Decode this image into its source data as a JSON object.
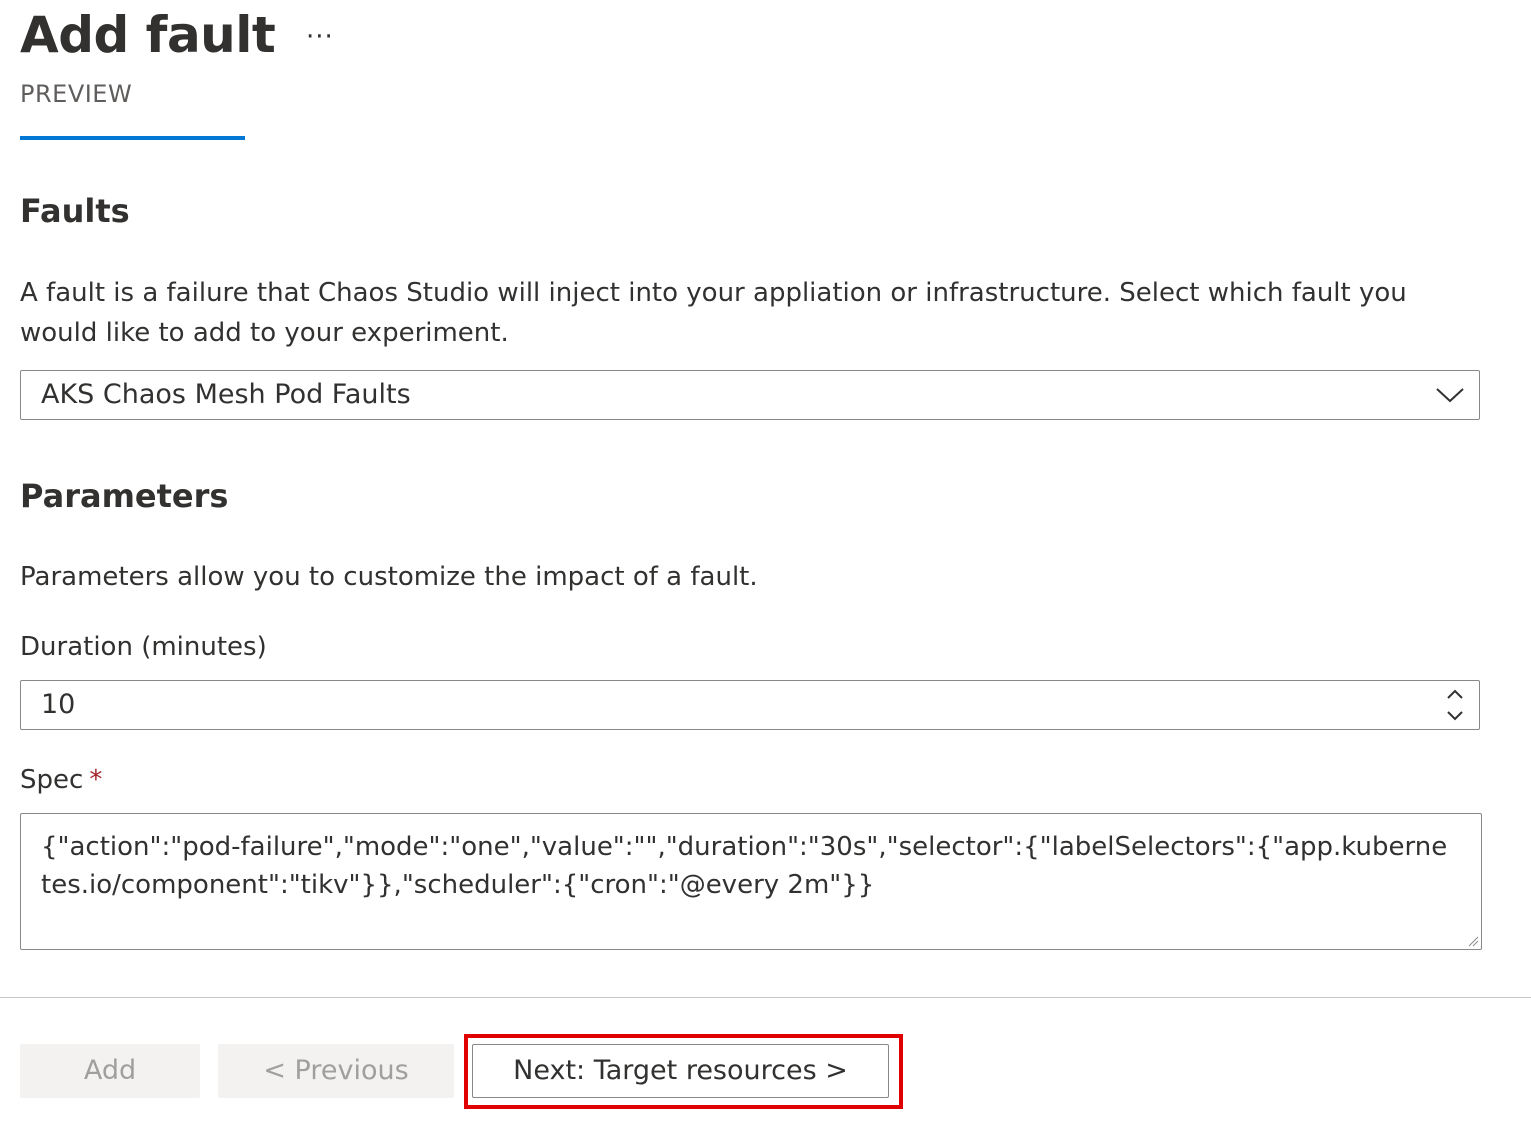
{
  "header": {
    "title": "Add fault",
    "more_label": "···",
    "tab_label": "PREVIEW"
  },
  "faults": {
    "title": "Faults",
    "description": "A fault is a failure that Chaos Studio will inject into your appliation or infrastructure. Select which fault you would like to add to your experiment.",
    "selected_fault": "AKS Chaos Mesh Pod Faults"
  },
  "parameters": {
    "title": "Parameters",
    "description": "Parameters allow you to customize the impact of a fault.",
    "duration_label": "Duration (minutes)",
    "duration_value": "10",
    "spec_label": "Spec",
    "spec_required_marker": "*",
    "spec_value": "{\"action\":\"pod-failure\",\"mode\":\"one\",\"value\":\"\",\"duration\":\"30s\",\"selector\":{\"labelSelectors\":{\"app.kubernetes.io/component\":\"tikv\"}},\"scheduler\":{\"cron\":\"@every 2m\"}}"
  },
  "footer": {
    "add_label": "Add",
    "previous_label": "< Previous",
    "next_label": "Next: Target resources >"
  },
  "colors": {
    "accent": "#0078d4",
    "highlight": "#e00000",
    "required": "#a4262c"
  }
}
